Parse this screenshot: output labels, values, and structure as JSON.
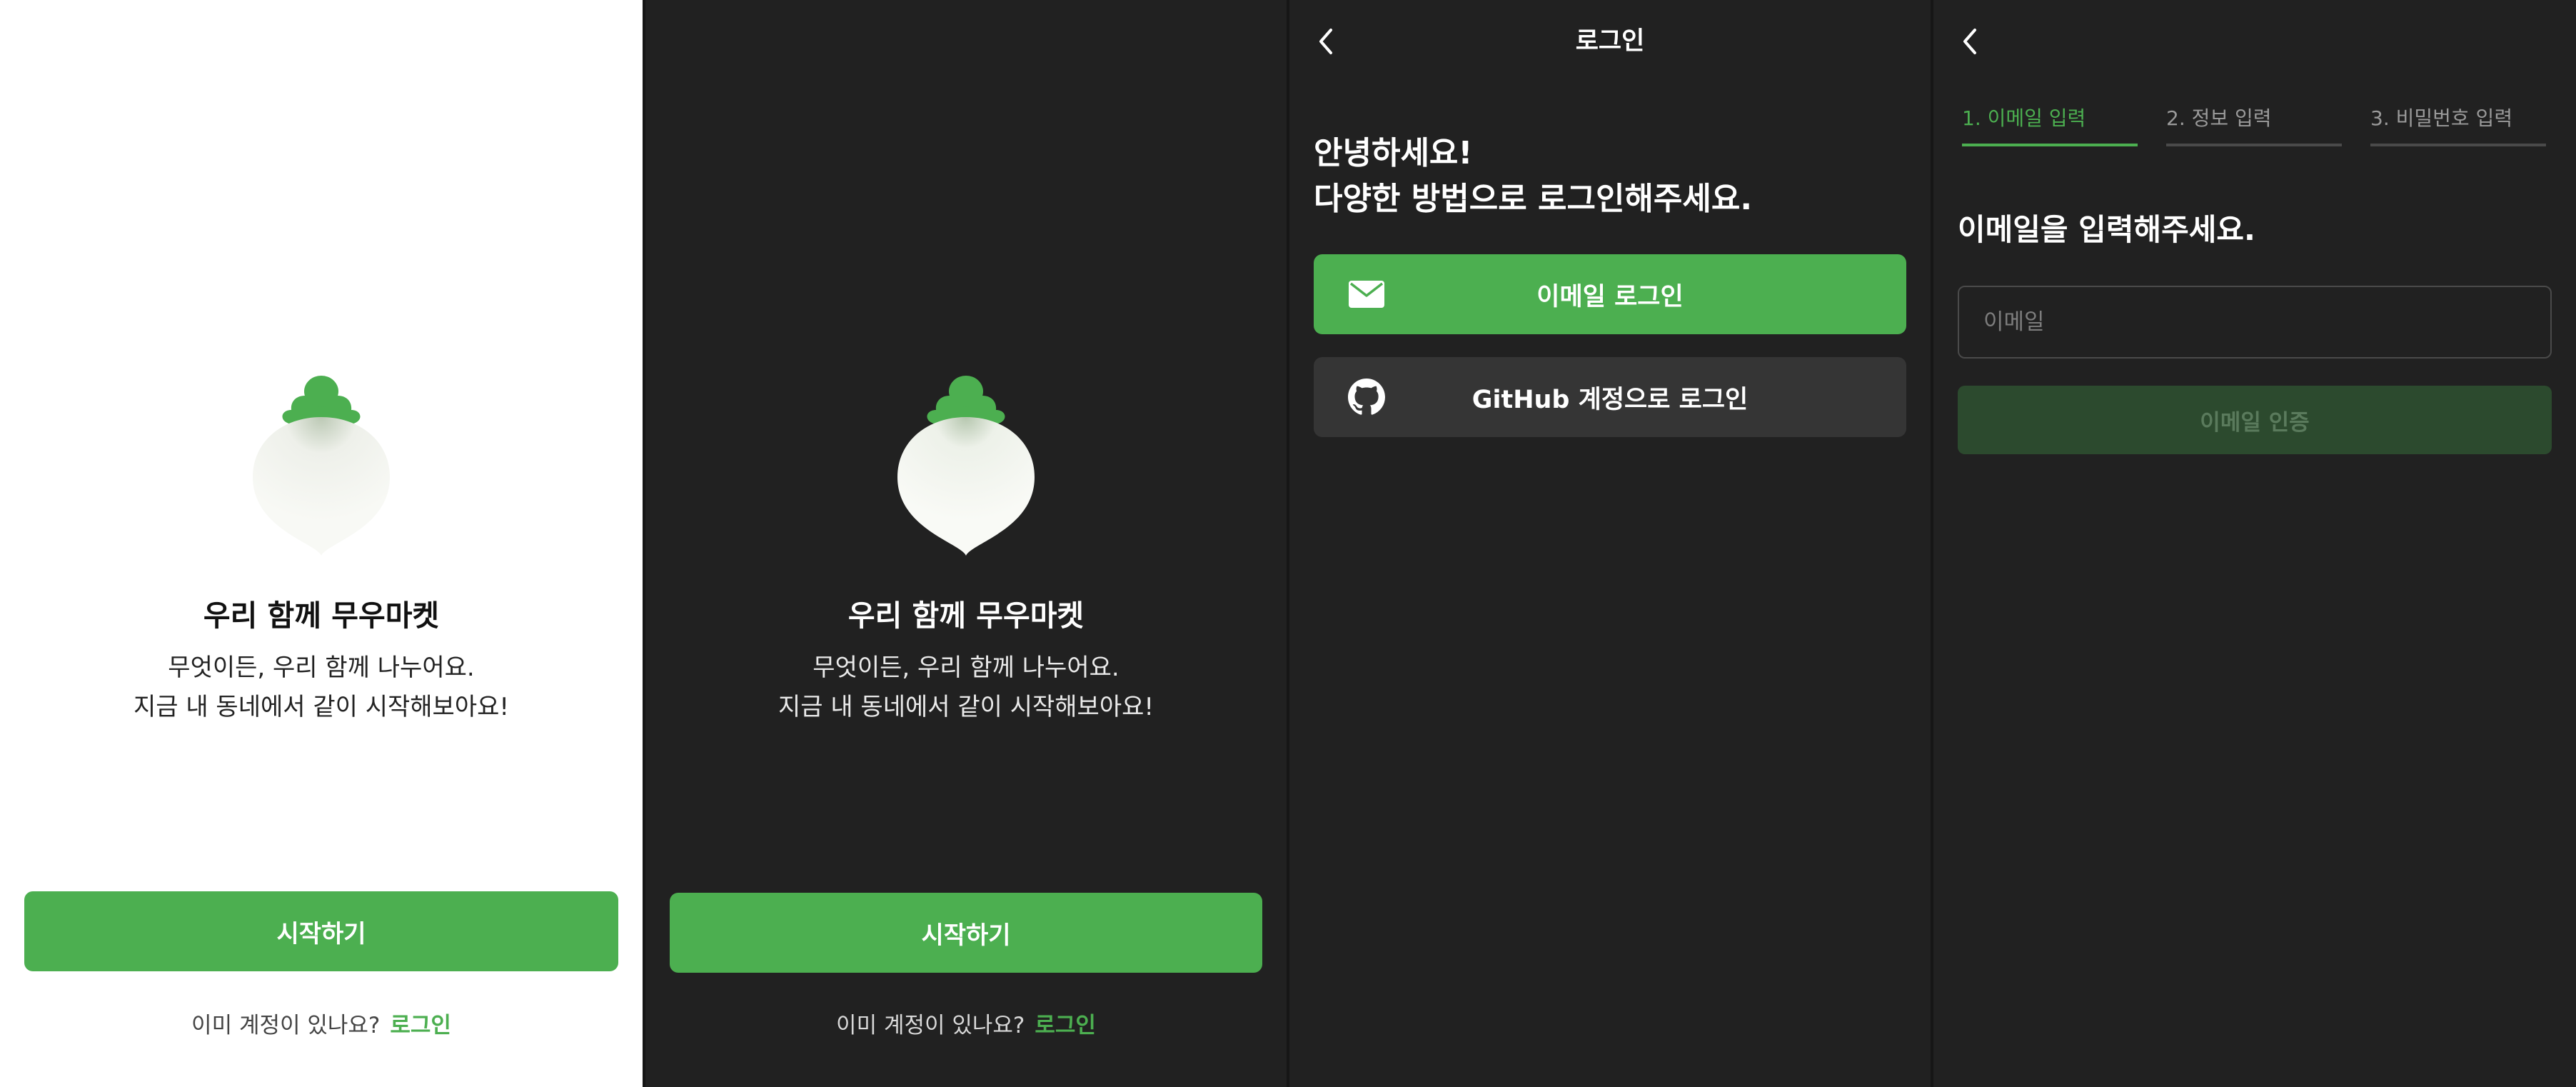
{
  "colors": {
    "accent": "#4caf50",
    "dark_bg": "#212121",
    "light_bg": "#ffffff",
    "github_button_bg": "#353535",
    "disabled_button_bg": "#2c4a2e"
  },
  "welcome": {
    "logo": "radish-logo",
    "title": "우리 함께 무우마켓",
    "line1": "무엇이든, 우리 함께 나누어요.",
    "line2": "지금 내 동네에서 같이 시작해보아요!",
    "start_button": "시작하기",
    "have_account": "이미 계정이 있나요?",
    "login_link": "로그인"
  },
  "login": {
    "back_icon": "chevron-left-icon",
    "title": "로그인",
    "greeting1": "안녕하세요!",
    "greeting2": "다양한 방법으로 로그인해주세요.",
    "email_button": "이메일 로그인",
    "email_icon": "mail-icon",
    "github_button": "GitHub 계정으로 로그인",
    "github_icon": "github-icon"
  },
  "signup": {
    "back_icon": "chevron-left-icon",
    "steps": [
      {
        "label": "1. 이메일 입력",
        "active": true
      },
      {
        "label": "2. 정보 입력",
        "active": false
      },
      {
        "label": "3. 비밀번호 입력",
        "active": false
      }
    ],
    "heading": "이메일을 입력해주세요.",
    "email_placeholder": "이메일",
    "email_value": "",
    "verify_button": "이메일 인증"
  }
}
